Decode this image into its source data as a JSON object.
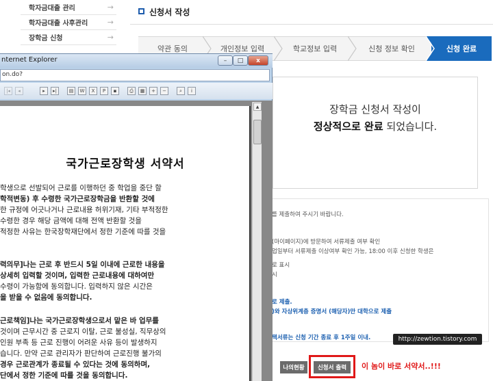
{
  "sidebar": {
    "items": [
      {
        "label": "학자금대출 관리",
        "arrow": "→"
      },
      {
        "label": "학자금대출 사후관리",
        "arrow": "→"
      },
      {
        "label": "장학금 신청",
        "arrow": "→"
      }
    ]
  },
  "main": {
    "title": "신청서 작성",
    "steps": [
      "약관 동의",
      "개인정보 입력",
      "학교정보 입력",
      "신청 정보 확인",
      "신청 완료"
    ],
    "active_step": 4,
    "complete": {
      "line1": "장학금 신청서 작성이",
      "line2_bold": "정상적으로 완료",
      "line2_rest": " 되었습니다."
    },
    "notice_lines": [
      "를 제출하여 주시기 바랍니다.",
      "(마이페이지)에 방문하여 서류제출 여부 확인",
      "업일부터 서류제출 이상여부 확인 가능, 18:00 이후 신청한 학생은",
      "로 표시",
      "시",
      "로 제출.",
      ")와 자상위계층 증명서 (해당자)만 대학으로 제출",
      "택서류는 신청 기간 종료 후 1주일 이내."
    ],
    "buttons": {
      "my_status": "나의현황",
      "print_application": "신청서 출력"
    },
    "annotation": "이 놈이 바로 서약서..!!!",
    "watermark": "http://zewtion.tistory.com"
  },
  "ie_window": {
    "title": "nternet Explorer",
    "url": "on.do?",
    "buttons": {
      "minimize": "–",
      "maximize": "□",
      "close": "x"
    }
  },
  "document": {
    "title": "국가근로장학생 서약서",
    "para1": [
      "학생으로 선발되어 근로를 이행하던 중 학업을 중단 할",
      "학적변동) 후 수령한 국가근로장학금을 반환할 것에",
      "한 규정에 어긋나거나 근로내용 허위기재, 기타 부적정한",
      "수령한 경우 해당 금액에 대해 전액 반환할 것을",
      "적정한 사유는 한국장학재단에서 정한 기준에 따를 것을"
    ],
    "para2": [
      "력의무]나는 근로 후 반드시 5일 이내에 근로한 내용을",
      "상세히 입력할 것이며, 입력한 근로내용에 대하여만",
      "수령이 가능함에 동의합니다. 입력하지 않은 시간은",
      "을 받을 수 없음에 동의합니다."
    ],
    "para3": [
      "근로책임]나는 국가근로장학생으로서 맡은 바 업무를",
      "것이며 근무시간 중 근로지 이탈, 근로 불성실, 직무상의",
      "인원 부족 등 근로 진행이 어려운 사유 등이 발생하지",
      "습니다. 만약 근로 관리자가 판단하여 근로진행 불가의",
      "경우 근로관계가 종료될 수 있다는 것에 동의하며,",
      "단에서 정한 기준에 따를 것을 동의합니다."
    ]
  },
  "colors": {
    "accent": "#1a6bbd",
    "highlight": "#e01818",
    "button": "#6b6b6b"
  }
}
